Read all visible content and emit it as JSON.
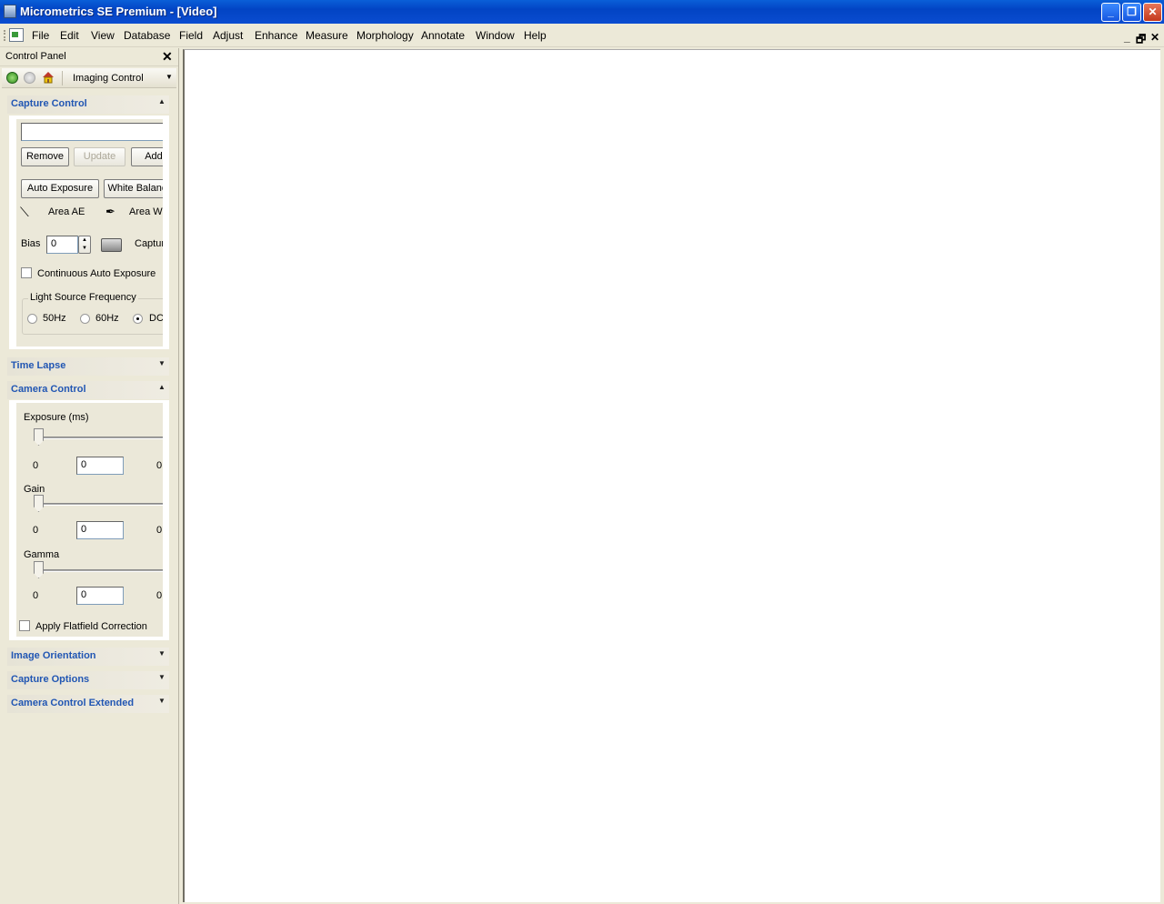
{
  "window": {
    "title": "Micrometrics SE Premium - [Video]",
    "controls": [
      "minimize",
      "restore",
      "close"
    ]
  },
  "menubar": {
    "items": [
      "File",
      "Edit",
      "View",
      "Database",
      "Field",
      "Adjust",
      "Enhance",
      "Measure",
      "Morphology",
      "Annotate",
      "Window",
      "Help"
    ],
    "mdi_controls": [
      "_",
      "🗗",
      "✕"
    ]
  },
  "control_panel": {
    "title": "Control Panel",
    "close": "✕",
    "nav": {
      "selected": "Imaging Control"
    },
    "sections": {
      "capture_control": {
        "title": "Capture Control",
        "name_input": "",
        "buttons": {
          "remove": "Remove",
          "update": "Update",
          "add": "Add",
          "auto_exposure": "Auto Exposure",
          "white_balance": "White Balance"
        },
        "area_ae": "Area AE",
        "area_wb": "Area WB",
        "bias_label": "Bias",
        "bias_value": "0",
        "capture": "Capture",
        "continuous": "Continuous Auto Exposure",
        "continuous_checked": false,
        "light_source": {
          "legend": "Light Source Frequency",
          "options": [
            "50Hz",
            "60Hz",
            "DC"
          ],
          "selected": "DC"
        }
      },
      "time_lapse": {
        "title": "Time Lapse"
      },
      "camera_control": {
        "title": "Camera Control",
        "exposure": {
          "label": "Exposure (ms)",
          "min": "0",
          "value": "0",
          "max": "0"
        },
        "gain": {
          "label": "Gain",
          "min": "0",
          "value": "0",
          "max": "0"
        },
        "gamma": {
          "label": "Gamma",
          "min": "0",
          "value": "0",
          "max": "0"
        },
        "flatfield": "Apply Flatfield Correction",
        "flatfield_checked": false
      },
      "image_orientation": {
        "title": "Image Orientation"
      },
      "capture_options": {
        "title": "Capture Options"
      },
      "camera_control_extended": {
        "title": "Camera Control Extended"
      }
    }
  }
}
